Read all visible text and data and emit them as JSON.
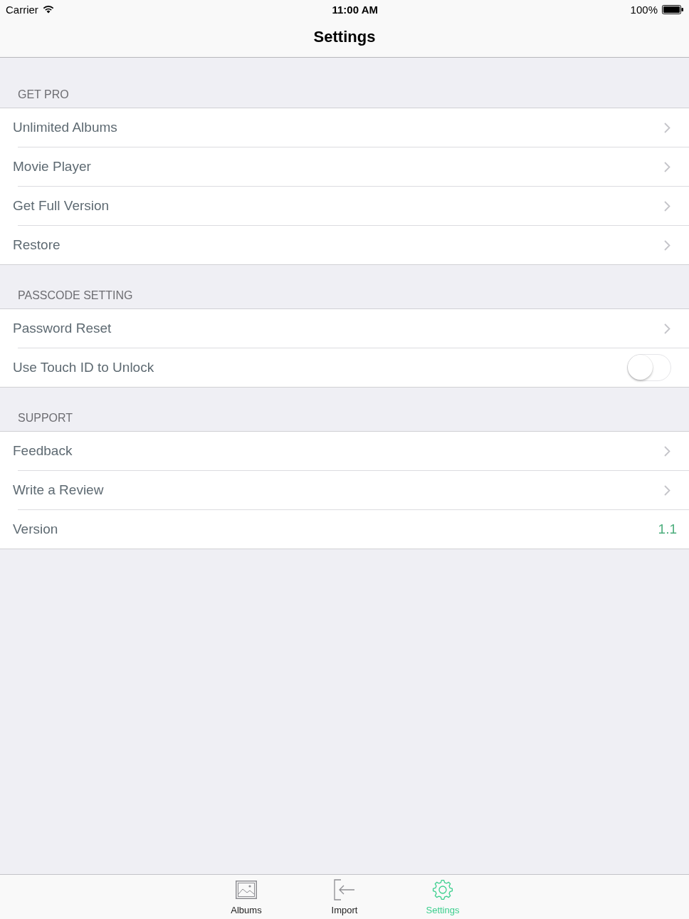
{
  "status_bar": {
    "carrier": "Carrier",
    "time": "11:00 AM",
    "battery": "100%"
  },
  "nav_bar": {
    "title": "Settings"
  },
  "sections": [
    {
      "header": "GET PRO",
      "rows": [
        {
          "kind": "disclosure",
          "label": "Unlimited Albums"
        },
        {
          "kind": "disclosure",
          "label": "Movie Player"
        },
        {
          "kind": "disclosure",
          "label": "Get Full Version"
        },
        {
          "kind": "disclosure",
          "label": "Restore"
        }
      ]
    },
    {
      "header": "PASSCODE SETTING",
      "rows": [
        {
          "kind": "disclosure",
          "label": "Password Reset"
        },
        {
          "kind": "toggle",
          "label": "Use Touch ID to Unlock",
          "on": false
        }
      ]
    },
    {
      "header": "SUPPORT",
      "rows": [
        {
          "kind": "disclosure",
          "label": "Feedback"
        },
        {
          "kind": "disclosure",
          "label": "Write a Review"
        },
        {
          "kind": "value",
          "label": "Version",
          "value": "1.1"
        }
      ]
    }
  ],
  "tab_bar": {
    "tabs": [
      {
        "label": "Albums",
        "selected": false
      },
      {
        "label": "Import",
        "selected": false
      },
      {
        "label": "Settings",
        "selected": true
      }
    ]
  }
}
